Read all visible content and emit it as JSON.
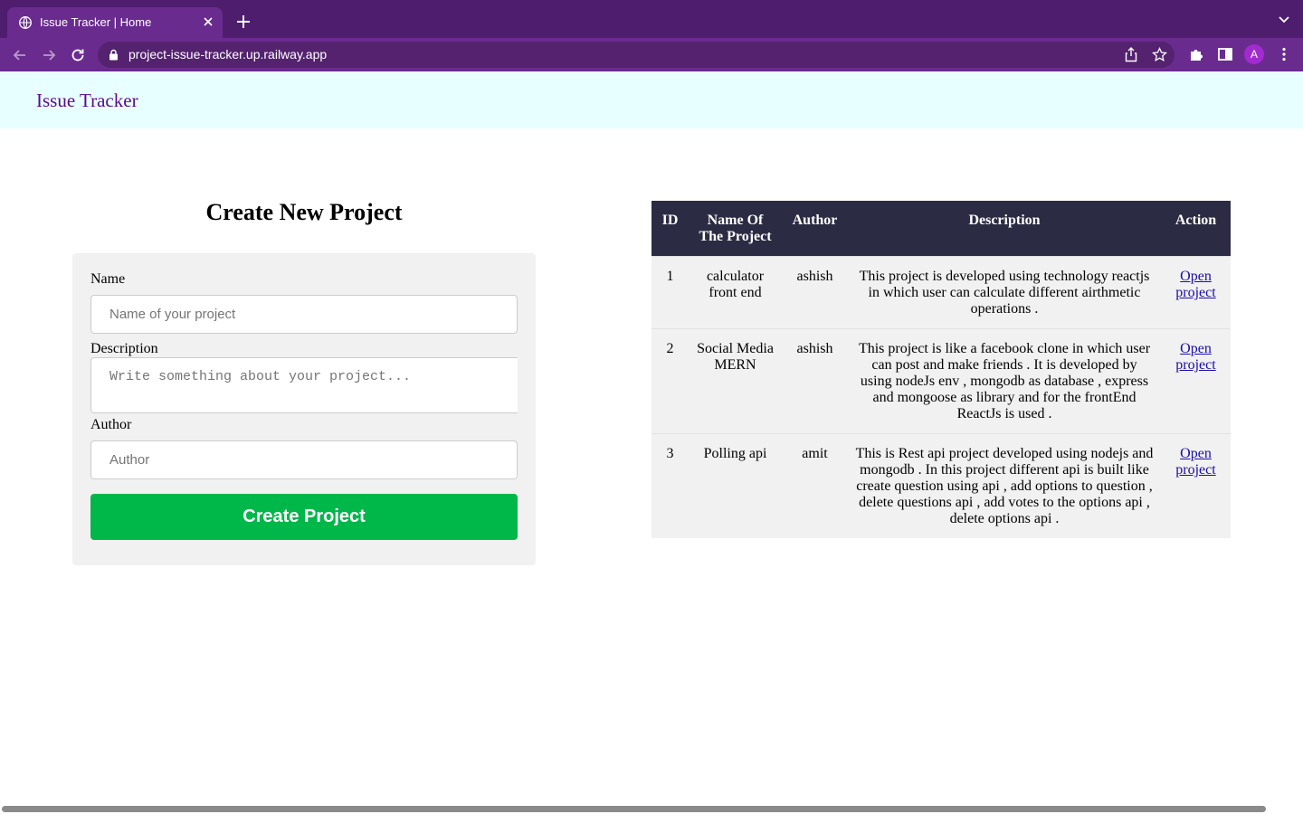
{
  "browser": {
    "tab_title": "Issue Tracker | Home",
    "url": "project-issue-tracker.up.railway.app",
    "profile_initial": "A"
  },
  "app": {
    "brand": "Issue Tracker"
  },
  "form": {
    "title": "Create New Project",
    "name_label": "Name",
    "name_placeholder": "Name of your project",
    "description_label": "Description",
    "description_placeholder": "Write something about your project...",
    "author_label": "Author",
    "author_placeholder": "Author",
    "submit_label": "Create Project"
  },
  "table": {
    "headers": [
      "ID",
      "Name Of The Project",
      "Author",
      "Description",
      "Action"
    ],
    "rows": [
      {
        "id": "1",
        "name": "calculator front end",
        "author": "ashish",
        "description": "This project is developed using technology reactjs in which user can calculate different airthmetic operations .",
        "action": "Open project"
      },
      {
        "id": "2",
        "name": "Social Media MERN",
        "author": "ashish",
        "description": "This project is like a facebook clone in which user can post and make friends . It is developed by using nodeJs env , mongodb as database , express and mongoose as library and for the frontEnd ReactJs is used .",
        "action": "Open project"
      },
      {
        "id": "3",
        "name": "Polling api",
        "author": "amit",
        "description": "This is Rest api project developed using nodejs and mongodb . In this project different api is built like create question using api , add options to question , delete questions api , add votes to the options api , delete options api .",
        "action": "Open project"
      }
    ]
  },
  "colors": {
    "tab_strip": "#4f1d6e",
    "toolbar": "#6a2b8f",
    "header_bg": "#e8ffff",
    "brand": "#5c0a8a",
    "table_header": "#2b2b43",
    "button": "#00b74a",
    "card": "#f1f1f1"
  },
  "icons": {
    "favicon": "globe-icon",
    "tab_close": "close-icon",
    "new_tab": "plus-icon",
    "back": "arrow-left-icon",
    "forward": "arrow-right-icon",
    "reload": "reload-icon",
    "lock": "lock-icon",
    "share": "share-icon",
    "bookmark": "star-icon",
    "extensions": "puzzle-icon",
    "side_panel": "side-panel-icon",
    "menu": "kebab-menu-icon"
  }
}
